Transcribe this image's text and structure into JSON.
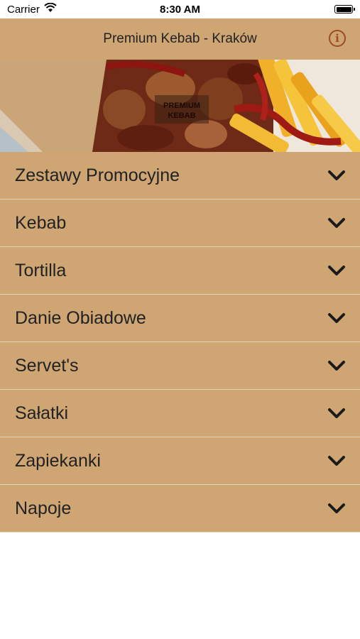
{
  "status_bar": {
    "carrier": "Carrier",
    "time": "8:30 AM"
  },
  "header": {
    "title": "Premium Kebab - Kraków",
    "info_icon": "info-icon"
  },
  "banner": {
    "logo_text_top": "PREMIUM",
    "logo_text_bottom": "KEBAB"
  },
  "menu": {
    "items": [
      {
        "label": "Zestawy Promocyjne"
      },
      {
        "label": "Kebab"
      },
      {
        "label": "Tortilla"
      },
      {
        "label": "Danie Obiadowe"
      },
      {
        "label": "Servet's"
      },
      {
        "label": "Sałatki"
      },
      {
        "label": "Zapiekanki"
      },
      {
        "label": "Napoje"
      }
    ]
  },
  "colors": {
    "bar": "#cfa574",
    "divider": "#e6d3bb",
    "accent": "#9a4b22"
  }
}
